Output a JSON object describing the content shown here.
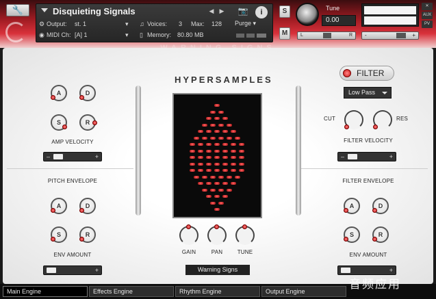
{
  "header": {
    "instrument_name": "Disquieting Signals",
    "output_label": "Output:",
    "output_value": "st. 1",
    "voices_label": "Voices:",
    "voices_value": "3",
    "max_label": "Max:",
    "max_value": "128",
    "purge_label": "Purge",
    "midi_label": "MIDI Ch:",
    "midi_value": "[A] 1",
    "memory_label": "Memory:",
    "memory_value": "80.80 MB",
    "solo_label": "S",
    "mute_label": "M",
    "tune_label": "Tune",
    "tune_value": "0.00",
    "pan_left": "L",
    "pan_right": "R",
    "vol_minus": "-",
    "vol_plus": "+",
    "aux_label": "AUX",
    "pv_label": "PV",
    "banner": "WARNING SIGNS"
  },
  "logo": "HYPERSAMPLES",
  "amp": {
    "knobs": [
      "A",
      "D",
      "S",
      "R"
    ],
    "label": "AMP VELOCITY"
  },
  "pitch_env": {
    "title": "PITCH ENVELOPE",
    "knobs": [
      "A",
      "D",
      "S",
      "R"
    ],
    "amount_label": "ENV AMOUNT"
  },
  "filter": {
    "button_label": "FILTER",
    "type": "Low Pass",
    "cut_label": "CUT",
    "res_label": "RES",
    "velocity_label": "FILTER VELOCITY"
  },
  "filter_env": {
    "title": "FILTER ENVELOPE",
    "knobs": [
      "A",
      "D",
      "S",
      "R"
    ],
    "amount_label": "ENV AMOUNT"
  },
  "center": {
    "gain_label": "GAIN",
    "pan_label": "PAN",
    "tune_label": "TUNE",
    "preset_name": "Warning Signs"
  },
  "slider": {
    "minus": "–",
    "plus": "+"
  },
  "tabs": [
    "Main Engine",
    "Effects Engine",
    "Rhythm Engine",
    "Output Engine"
  ],
  "watermark": "音频应用",
  "colors": {
    "accent": "#c81e28",
    "led": "#ff4a4a"
  }
}
